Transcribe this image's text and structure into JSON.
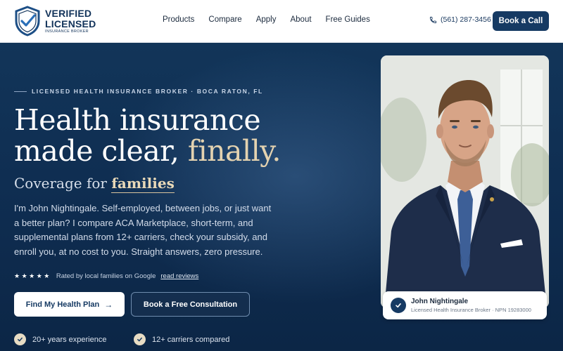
{
  "brand": {
    "logo_line1": "VERIFIED",
    "logo_line2": "LICENSED",
    "logo_line3": "INSURANCE BROKER"
  },
  "nav": {
    "items": [
      {
        "label": "Products"
      },
      {
        "label": "Compare"
      },
      {
        "label": "Apply"
      },
      {
        "label": "About"
      },
      {
        "label": "Free Guides"
      }
    ]
  },
  "header": {
    "phone": "(561) 287-3456",
    "cta": "Book a Call"
  },
  "hero": {
    "eyebrow": "LICENSED HEALTH INSURANCE BROKER · BOCA RATON, FL",
    "headline_line1": "Health insurance",
    "headline_line2_plain": "made clear, ",
    "headline_line2_accent": "finally.",
    "sub_prefix": "Coverage for ",
    "sub_emphasis": "families",
    "description": "I'm John Nightingale. Self-employed, between jobs, or just want a better plan? I compare ACA Marketplace, short-term, and supplemental plans from 12+ carriers, check your subsidy, and enroll you, at no cost to you. Straight answers, zero pressure.",
    "stars": "★★★★★",
    "rating_text": "Rated by local families on Google",
    "reviews_link": "read reviews",
    "primary_button": "Find My Health Plan",
    "primary_button_arrow": "→",
    "secondary_button": "Book a Free Consultation",
    "features": [
      {
        "label": "20+ years experience"
      },
      {
        "label": "12+ carriers compared"
      }
    ]
  },
  "agent_card": {
    "name": "John Nightingale",
    "credential": "Licensed Health Insurance Broker · NPN 19283000"
  },
  "colors": {
    "navy": "#163a63",
    "accent_gold": "#e3d2b0",
    "hero_bg": "#0f2e52"
  }
}
